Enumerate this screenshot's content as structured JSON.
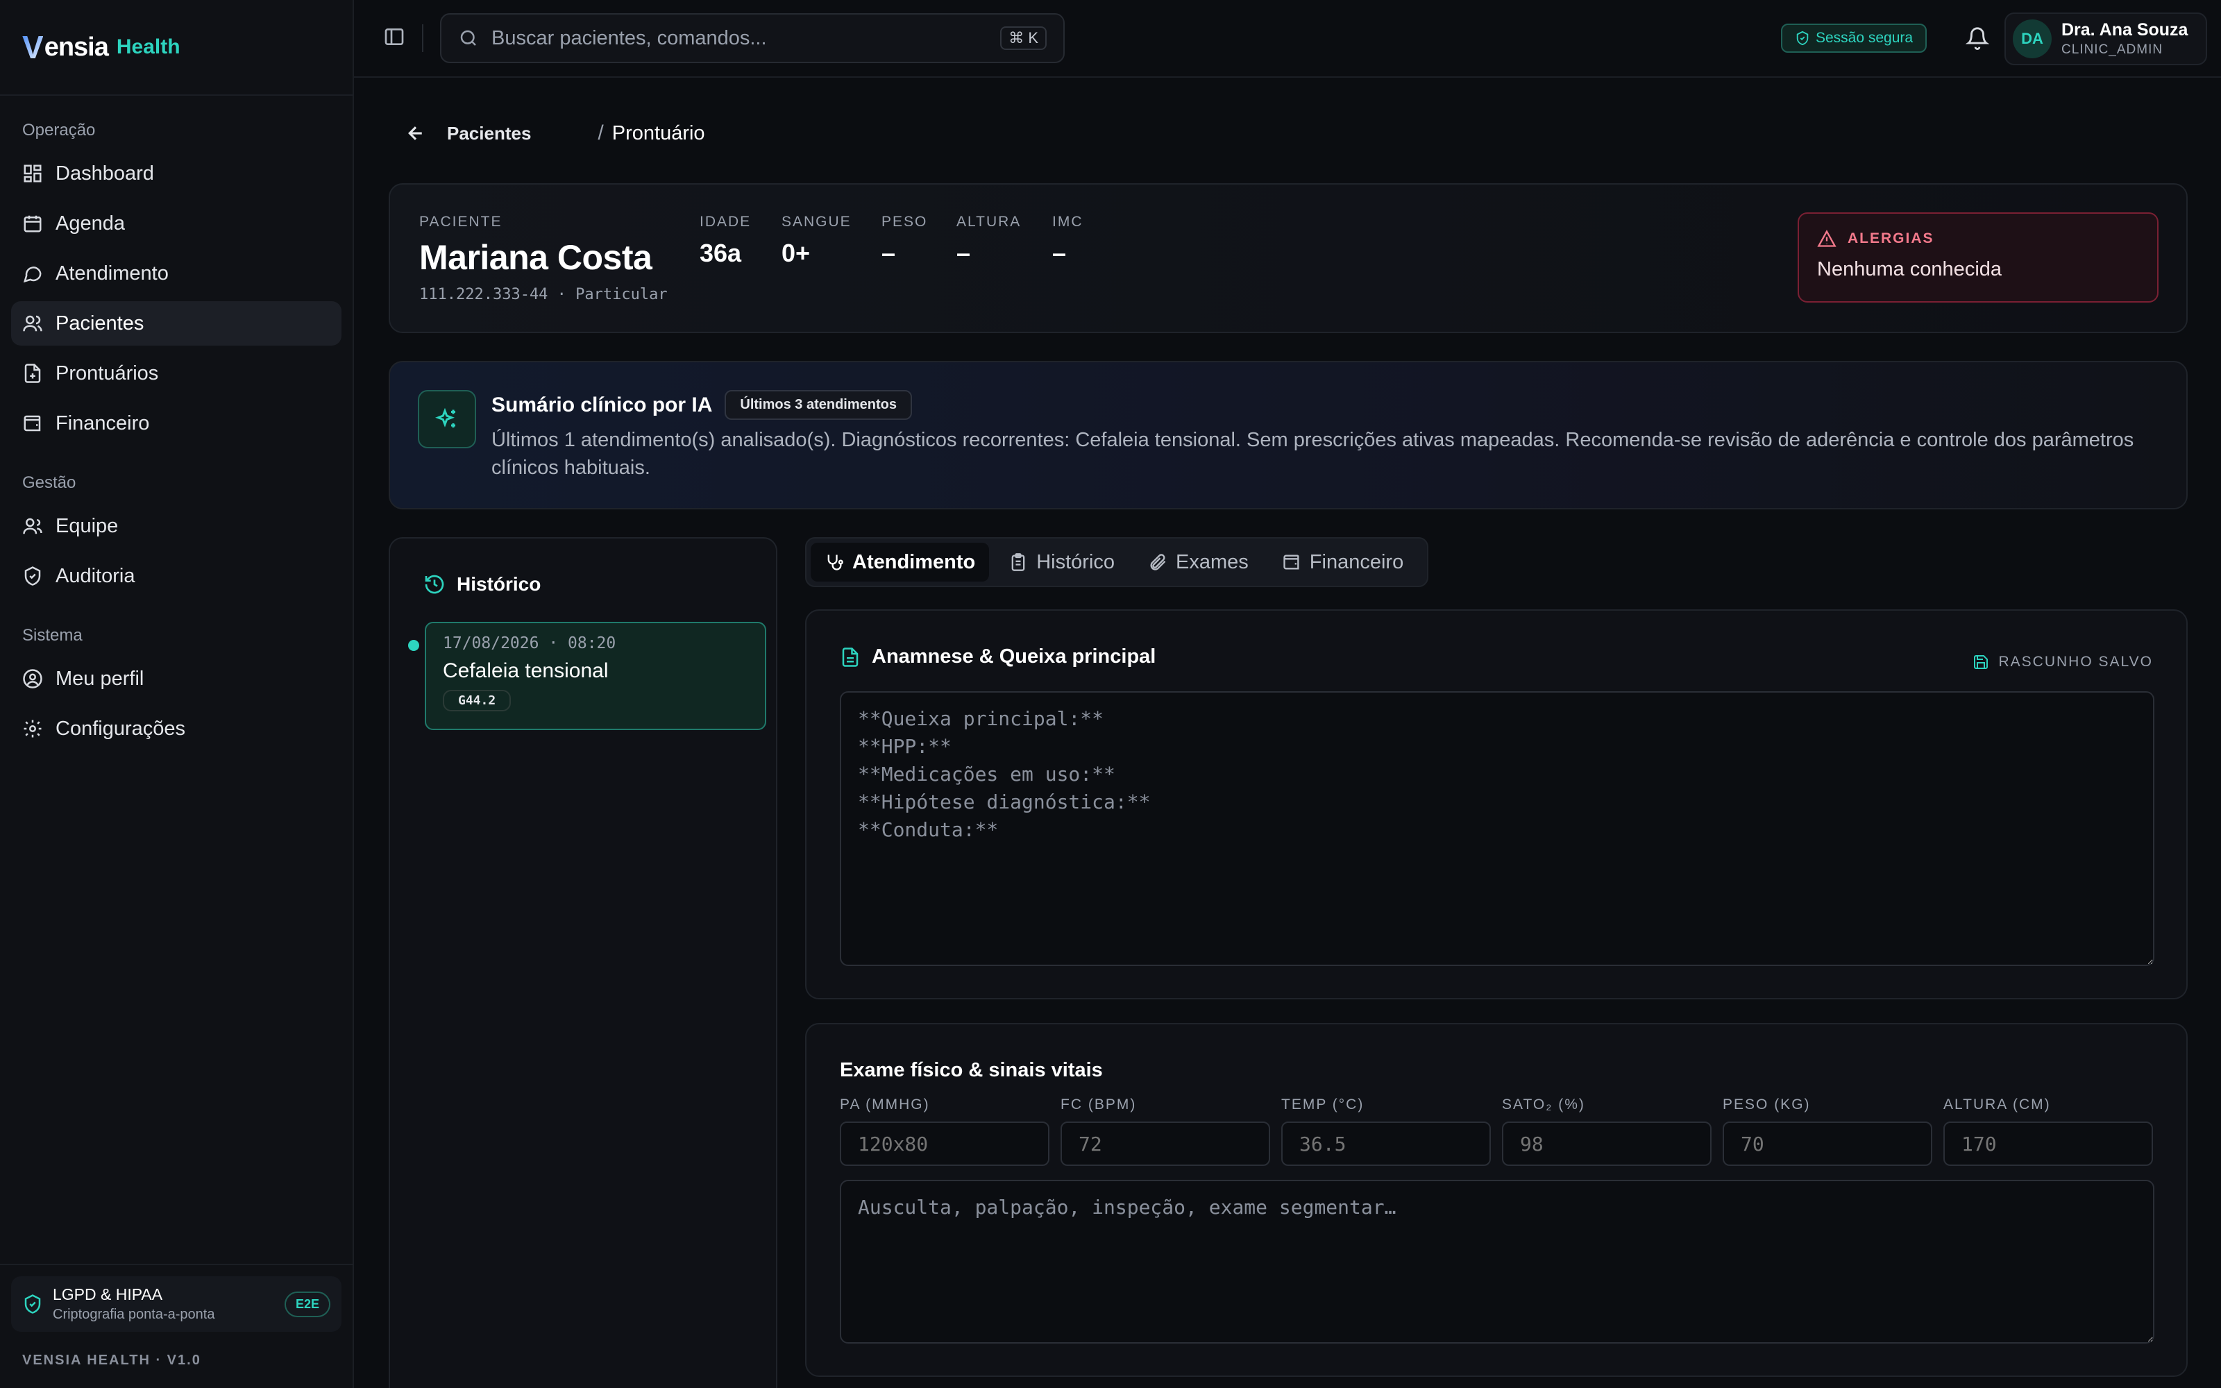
{
  "brand": {
    "logo_text": "ensia",
    "logo_letter": "V",
    "product": "Health"
  },
  "sidebar": {
    "sections": [
      {
        "heading": "Operação",
        "items": [
          {
            "label": "Dashboard",
            "icon": "dashboard-icon"
          },
          {
            "label": "Agenda",
            "icon": "calendar-icon"
          },
          {
            "label": "Atendimento",
            "icon": "chat-icon"
          },
          {
            "label": "Pacientes",
            "icon": "users-icon",
            "active": true
          },
          {
            "label": "Prontuários",
            "icon": "file-medical-icon"
          },
          {
            "label": "Financeiro",
            "icon": "wallet-icon"
          }
        ]
      },
      {
        "heading": "Gestão",
        "items": [
          {
            "label": "Equipe",
            "icon": "team-icon"
          },
          {
            "label": "Auditoria",
            "icon": "shield-check-icon"
          }
        ]
      },
      {
        "heading": "Sistema",
        "items": [
          {
            "label": "Meu perfil",
            "icon": "user-circle-icon"
          },
          {
            "label": "Configurações",
            "icon": "gear-icon"
          }
        ]
      }
    ],
    "compliance": {
      "title": "LGPD & HIPAA",
      "subtitle": "Criptografia ponta-a-ponta",
      "badge": "E2E"
    },
    "version": "VENSIA HEALTH · V1.0"
  },
  "topbar": {
    "search_placeholder": "Buscar pacientes, comandos...",
    "shortcut": "⌘ K",
    "secure_label": "Sessão segura",
    "user": {
      "initials": "DA",
      "name": "Dra. Ana Souza",
      "role": "CLINIC_ADMIN"
    }
  },
  "breadcrumb": {
    "back": "Pacientes",
    "separator": "/",
    "current": "Prontuário"
  },
  "patient": {
    "label": "PACIENTE",
    "name": "Mariana Costa",
    "document": "111.222.333-44 · Particular",
    "stats": [
      {
        "label": "IDADE",
        "value": "36a"
      },
      {
        "label": "SANGUE",
        "value": "0+"
      },
      {
        "label": "PESO",
        "value": "–"
      },
      {
        "label": "ALTURA",
        "value": "–"
      },
      {
        "label": "IMC",
        "value": "–"
      }
    ],
    "allergies": {
      "label": "ALERGIAS",
      "value": "Nenhuma conhecida"
    }
  },
  "ai_summary": {
    "title": "Sumário clínico por IA",
    "badge": "Últimos 3 atendimentos",
    "text": "Últimos 1 atendimento(s) analisado(s). Diagnósticos recorrentes: Cefaleia tensional. Sem prescrições ativas mapeadas. Recomenda-se revisão de aderência e controle dos parâmetros clínicos habituais."
  },
  "history": {
    "title": "Histórico",
    "entries": [
      {
        "date": "17/08/2026 · 08:20",
        "diagnosis": "Cefaleia tensional",
        "code": "G44.2"
      }
    ]
  },
  "tabs": [
    {
      "label": "Atendimento",
      "icon": "stethoscope-icon",
      "active": true
    },
    {
      "label": "Histórico",
      "icon": "clipboard-icon"
    },
    {
      "label": "Exames",
      "icon": "paperclip-icon"
    },
    {
      "label": "Financeiro",
      "icon": "wallet-icon"
    }
  ],
  "anamnese": {
    "title": "Anamnese & Queixa principal",
    "draft_status": "RASCUNHO SALVO",
    "placeholder": "**Queixa principal:**\n**HPP:**\n**Medicações em uso:**\n**Hipótese diagnóstica:**\n**Conduta:**"
  },
  "exam": {
    "title": "Exame físico & sinais vitais",
    "vitals": [
      {
        "label": "PA (MMHG)",
        "placeholder": "120x80"
      },
      {
        "label": "FC (BPM)",
        "placeholder": "72"
      },
      {
        "label": "TEMP (°C)",
        "placeholder": "36.5"
      },
      {
        "label": "SATO₂ (%)",
        "placeholder": "98"
      },
      {
        "label": "PESO (KG)",
        "placeholder": "70"
      },
      {
        "label": "ALTURA (CM)",
        "placeholder": "170"
      }
    ],
    "notes_placeholder": "Ausculta, palpação, inspeção, exame segmentar…"
  }
}
